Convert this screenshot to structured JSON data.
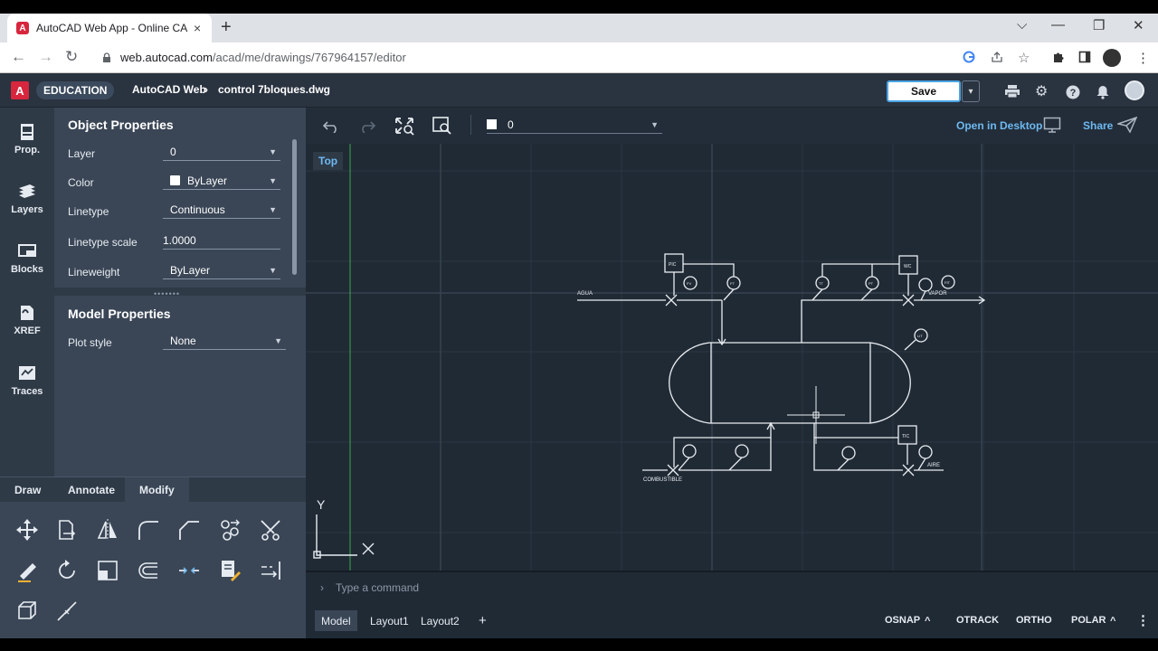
{
  "browser": {
    "tab_title": "AutoCAD Web App - Online CAD",
    "tab_close": "×",
    "new_tab": "+",
    "url_host": "web.autocad.com",
    "url_path": "/acad/me/drawings/767964157/editor",
    "window_controls": [
      "⌵",
      "—",
      "❐",
      "✕"
    ]
  },
  "header": {
    "logo": "A",
    "edition": "EDUCATION",
    "app_name": "AutoCAD Web",
    "separator": "›",
    "file_name": "control 7bloques.dwg",
    "save_label": "Save",
    "save_dropdown": "▾"
  },
  "rail": {
    "items": [
      {
        "label": "Prop.",
        "icon": "properties-icon"
      },
      {
        "label": "Layers",
        "icon": "layers-icon"
      },
      {
        "label": "Blocks",
        "icon": "blocks-icon"
      },
      {
        "label": "XREF",
        "icon": "xref-icon"
      },
      {
        "label": "Traces",
        "icon": "traces-icon"
      }
    ]
  },
  "object_properties": {
    "title": "Object Properties",
    "rows": [
      {
        "label": "Layer",
        "value": "0"
      },
      {
        "label": "Color",
        "value": "ByLayer"
      },
      {
        "label": "Linetype",
        "value": "Continuous"
      },
      {
        "label": "Linetype scale",
        "value": "1.0000"
      },
      {
        "label": "Lineweight",
        "value": "ByLayer"
      }
    ]
  },
  "model_properties": {
    "title": "Model Properties",
    "rows": [
      {
        "label": "Plot style",
        "value": "None"
      }
    ]
  },
  "tool_tabs": {
    "draw": "Draw",
    "annotate": "Annotate",
    "modify": "Modify",
    "active": "Modify"
  },
  "modify_tools": [
    "move-icon",
    "copy-icon",
    "mirror-icon",
    "fillet-icon",
    "chamfer-icon",
    "array-icon",
    "trim-icon",
    "erase-icon",
    "rotate-icon",
    "scale-icon",
    "offset-icon",
    "break-icon",
    "match-properties-icon",
    "extend-icon",
    "explode-icon",
    "stretch-icon"
  ],
  "drawbar": {
    "current_layer": "0",
    "open_in_desktop": "Open in Desktop",
    "share": "Share"
  },
  "canvas": {
    "view_label": "Top",
    "ucs_y": "Y",
    "drawing_labels": {
      "agua": "AGUA",
      "vapor": "VAPOR",
      "combustible": "COMBUSTIBLE",
      "aire": "AIRE",
      "pic": "PIC",
      "wc": "WC",
      "tic": "TIC",
      "fv": "FV",
      "ft": "FT",
      "tt": "TT",
      "pt": "PT",
      "fit": "FIT",
      "lit": "LIT"
    }
  },
  "command": {
    "prompt": "›",
    "placeholder": "Type a command"
  },
  "status": {
    "layouts": [
      "Model",
      "Layout1",
      "Layout2"
    ],
    "add": "+",
    "toggles": [
      "OSNAP",
      "OTRACK",
      "ORTHO",
      "POLAR"
    ],
    "caret": "^",
    "more": "⋮"
  },
  "colors": {
    "accent": "#6db9f2",
    "canvas_bg": "#202a35",
    "panel_bg": "#3a4656",
    "brand_red": "#d7263d"
  }
}
